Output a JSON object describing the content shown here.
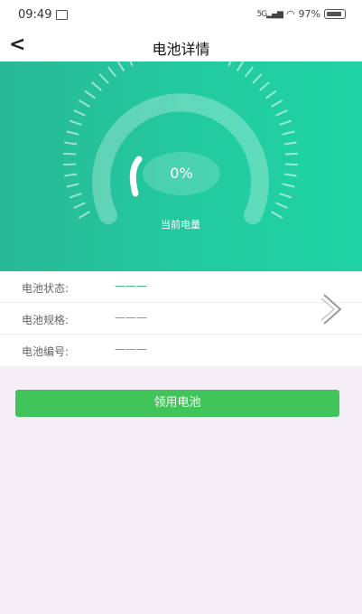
{
  "status": {
    "time": "09:49",
    "network": "5G",
    "battery_pct": "97%",
    "icons": [
      "image-icon",
      "signal-icon",
      "wifi-icon",
      "battery-icon"
    ]
  },
  "header": {
    "back_icon": "chevron-left-icon",
    "title": "电池详情"
  },
  "gauge": {
    "percent_text": "0%",
    "label": "当前电量",
    "level": 0
  },
  "info": {
    "rows": [
      {
        "label": "电池状态:",
        "value": "———"
      },
      {
        "label": "电池规格:",
        "value": "———"
      },
      {
        "label": "电池编号:",
        "value": "———"
      }
    ],
    "detail_icon": "chevron-right-icon"
  },
  "action": {
    "label": "领用电池"
  },
  "colors": {
    "hero": "#22cca0",
    "button": "#41c45a",
    "background": "#f4eef6"
  }
}
